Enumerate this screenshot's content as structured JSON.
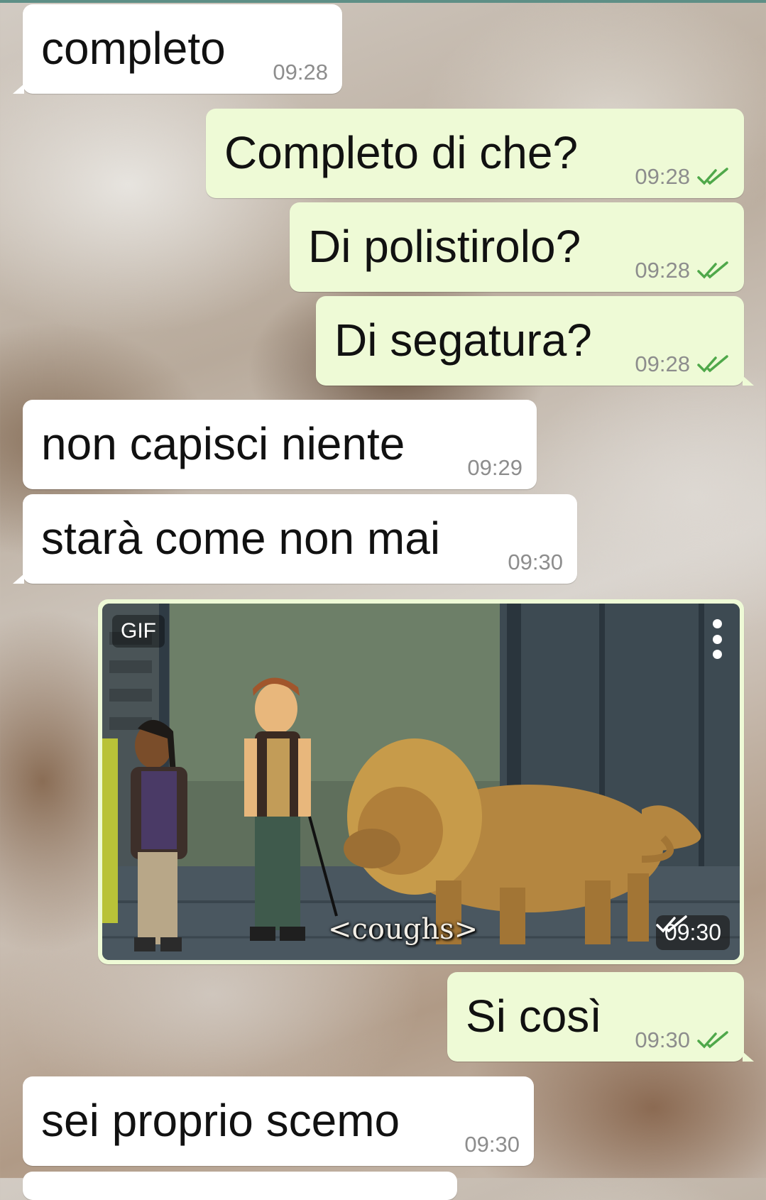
{
  "messages": [
    {
      "dir": "in",
      "text": "completo",
      "time": "09:28"
    },
    {
      "dir": "out",
      "text": "Completo di che?",
      "time": "09:28"
    },
    {
      "dir": "out",
      "text": "Di polistirolo?",
      "time": "09:28"
    },
    {
      "dir": "out",
      "text": "Di segatura?",
      "time": "09:28"
    },
    {
      "dir": "in",
      "text": "non capisci niente",
      "time": "09:29"
    },
    {
      "dir": "in",
      "text": "starà come non mai",
      "time": "09:30"
    },
    {
      "dir": "out",
      "type": "gif",
      "badge": "GIF",
      "caption": "<coughs>",
      "time": "09:30"
    },
    {
      "dir": "out",
      "text": "Si così",
      "time": "09:30"
    },
    {
      "dir": "in",
      "text": "sei proprio scemo",
      "time": "09:30"
    }
  ],
  "colors": {
    "incoming_bubble": "#ffffff",
    "outgoing_bubble": "#eefad6",
    "read_ticks": "#4fa84a",
    "timestamp": "#8d8d8d"
  },
  "icons": {
    "read_receipt": "double-check-icon",
    "gif_menu": "more-vertical-icon"
  }
}
